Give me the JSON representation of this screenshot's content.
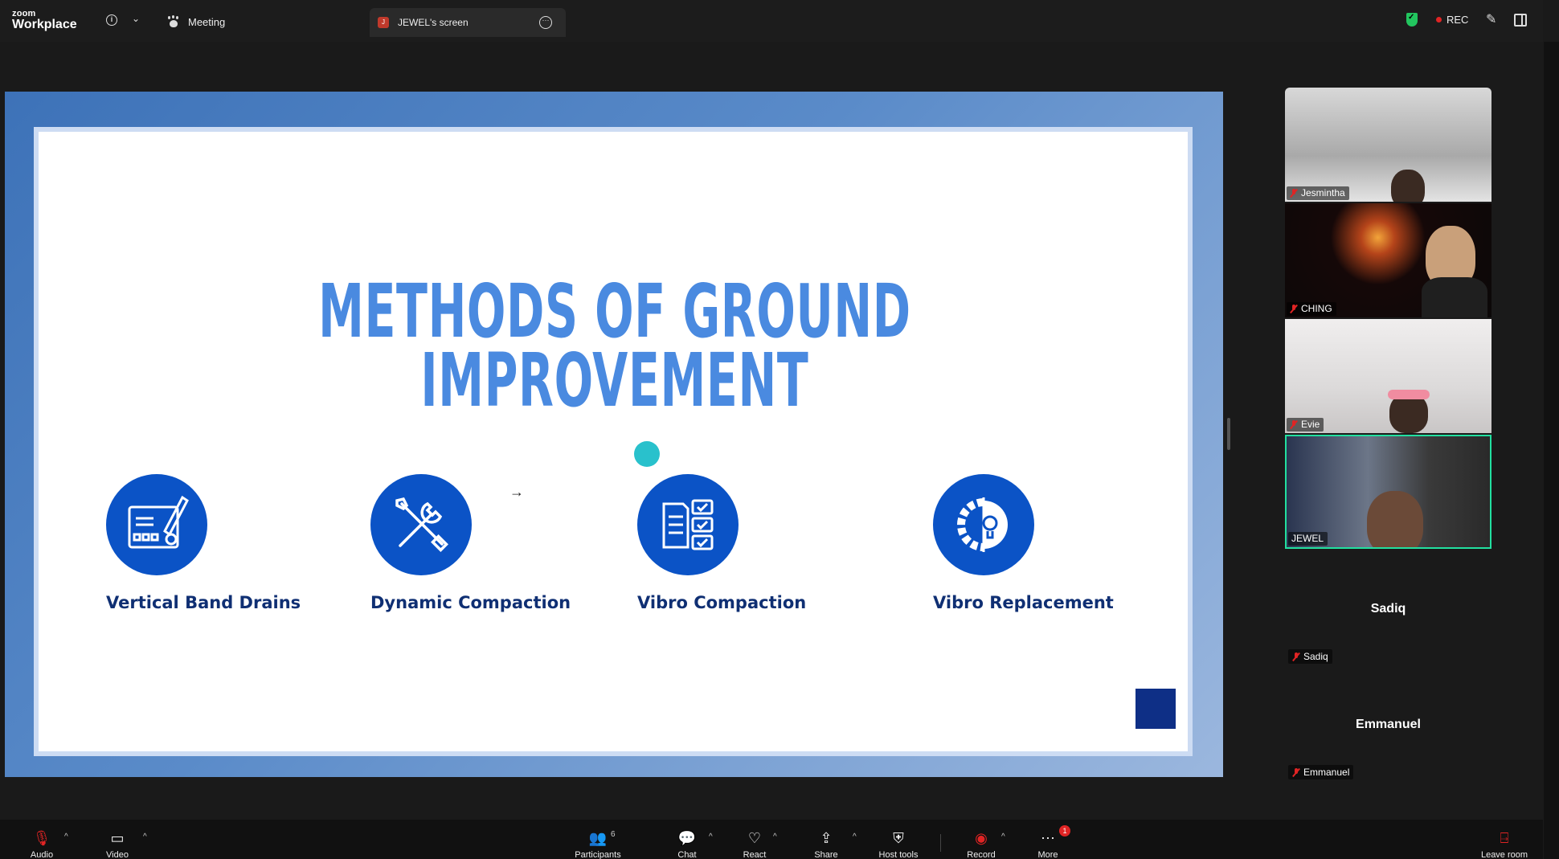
{
  "app": {
    "logo_small": "zoom",
    "logo_big": "Workplace"
  },
  "header": {
    "meeting_label": "Meeting",
    "screen_tab_label": "JEWEL's screen",
    "screen_tab_avatar": "J",
    "rec_label": "REC"
  },
  "slide": {
    "title_line1": "METHODS OF GROUND",
    "title_line2": "IMPROVEMENT",
    "methods": [
      {
        "label": "Vertical Band Drains",
        "icon": "blueprint-icon"
      },
      {
        "label": "Dynamic Compaction",
        "icon": "tools-icon"
      },
      {
        "label": "Vibro Compaction",
        "icon": "checklist-icon"
      },
      {
        "label": "Vibro Replacement",
        "icon": "gear-bulb-icon"
      }
    ],
    "colors": {
      "title": "#4a8ae0",
      "circle": "#0b53c6",
      "label": "#0f2f73",
      "accent_dot": "#29c1cc"
    }
  },
  "participants": [
    {
      "name": "Jesmintha",
      "video": true,
      "muted": true
    },
    {
      "name": "CHING",
      "video": true,
      "muted": true
    },
    {
      "name": "Evie",
      "video": true,
      "muted": true
    },
    {
      "name": "JEWEL",
      "video": true,
      "muted": false,
      "active_speaker": true
    },
    {
      "name": "Sadiq",
      "video": false,
      "muted": true
    },
    {
      "name": "Emmanuel",
      "video": false,
      "muted": true
    }
  ],
  "toolbar": {
    "audio": "Audio",
    "video": "Video",
    "participants": "Participants",
    "participants_count": "6",
    "chat": "Chat",
    "react": "React",
    "share": "Share",
    "host_tools": "Host tools",
    "record": "Record",
    "more": "More",
    "more_badge": "1",
    "leave": "Leave room"
  }
}
